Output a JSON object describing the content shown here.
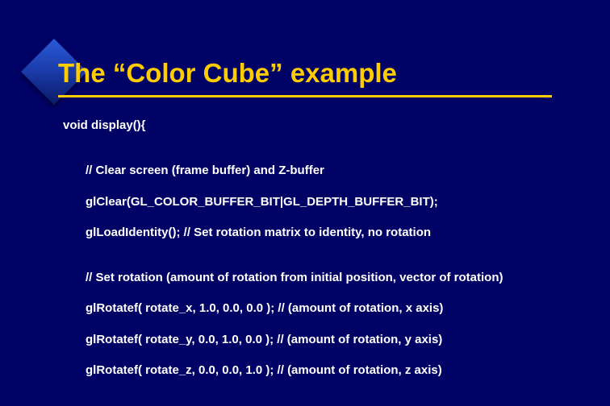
{
  "title": "The “Color Cube” example",
  "lines": [
    {
      "text": "void display(){",
      "indent": 0
    },
    {
      "text": "",
      "indent": 0,
      "spacer": true
    },
    {
      "text": "//  Clear screen (frame buffer) and Z-buffer",
      "indent": 1
    },
    {
      "text": "glClear(GL_COLOR_BUFFER_BIT|GL_DEPTH_BUFFER_BIT);",
      "indent": 1
    },
    {
      "text": "glLoadIdentity(); // Set rotation matrix to identity, no rotation",
      "indent": 1
    },
    {
      "text": "",
      "indent": 0,
      "spacer": true
    },
    {
      "text": "// Set rotation (amount of rotation from initial position, vector of rotation)",
      "indent": 1
    },
    {
      "text": "glRotatef( rotate_x, 1.0, 0.0, 0.0 ); // (amount of rotation, x axis)",
      "indent": 1
    },
    {
      "text": "glRotatef( rotate_y, 0.0, 1.0, 0.0 ); // (amount of rotation, y axis)",
      "indent": 1
    },
    {
      "text": "glRotatef( rotate_z, 0.0, 0.0, 1.0 ); // (amount of rotation, z axis)",
      "indent": 1
    }
  ]
}
